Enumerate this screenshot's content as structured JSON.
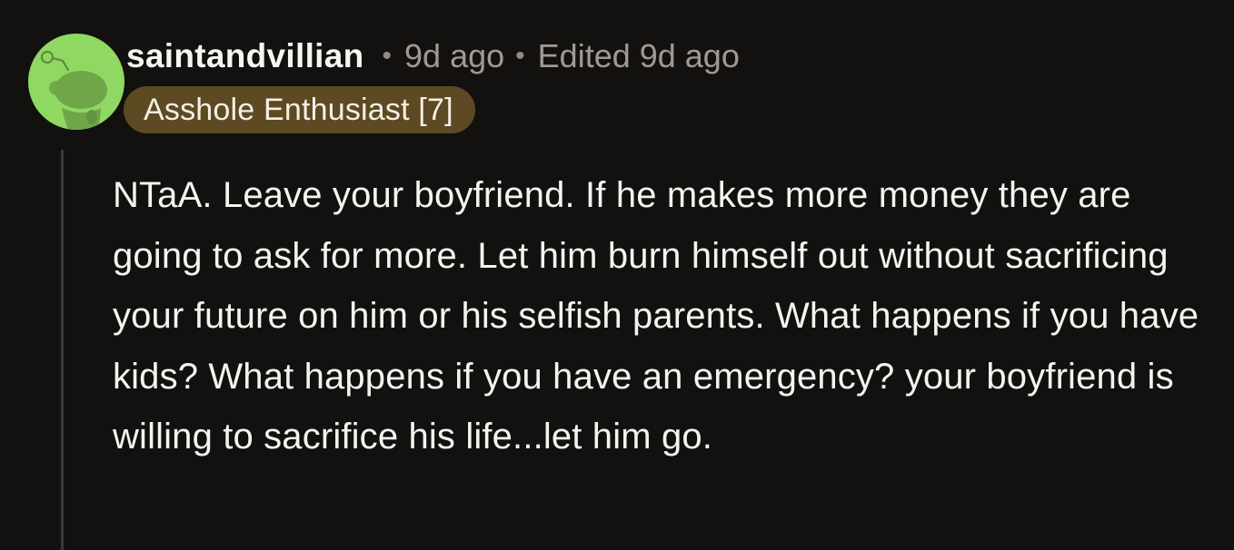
{
  "comment": {
    "author": "saintandvillian",
    "separator": "•",
    "timestamp": "9d ago",
    "edited": "Edited 9d ago",
    "flair": "Asshole Enthusiast [7]",
    "body": "NTaA. Leave your boyfriend. If he makes more money they are going to ask for more. Let him burn himself out without sacrificing your future on him or his selfish parents. What happens if you have kids? What happens if you have an emergency? your boyfriend is willing to sacrifice his life...let him go."
  },
  "avatar": {
    "icon": "snoo-avatar-icon",
    "background_color": "#8fd862"
  },
  "colors": {
    "background": "#13110f",
    "flair_background": "#5d4a23",
    "meta_text": "#a09a93"
  }
}
